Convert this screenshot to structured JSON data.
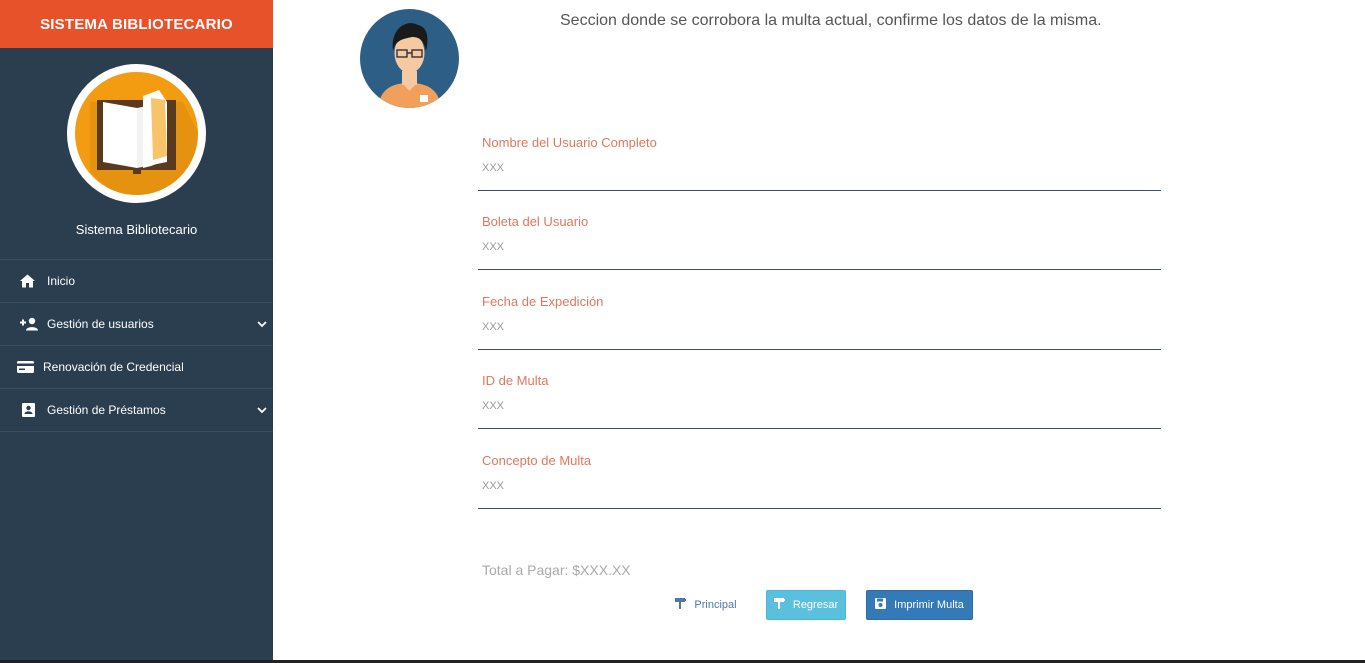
{
  "sidebar": {
    "title": "SISTEMA BIBLIOTECARIO",
    "name": "Sistema Bibliotecario",
    "items": [
      {
        "label": "Inicio",
        "icon": "home-icon"
      },
      {
        "label": "Gestión de usuarios",
        "icon": "add-user-icon"
      },
      {
        "label": "Renovación de Credencial",
        "icon": "credit-card-icon"
      },
      {
        "label": "Gestión de Préstamos",
        "icon": "contact-card-icon"
      }
    ]
  },
  "main": {
    "intro": "Seccion donde se corrobora la multa actual, confirme los datos de la misma.",
    "fields": [
      {
        "label": "Nombre del Usuario Completo",
        "value": "XXX"
      },
      {
        "label": "Boleta del Usuario",
        "value": "XXX"
      },
      {
        "label": "Fecha de Expedición",
        "value": "XXX"
      },
      {
        "label": "ID de Multa",
        "value": "XXX"
      },
      {
        "label": "Concepto de Multa",
        "value": "XXX"
      }
    ],
    "total": "Total a Pagar: $XXX.XX",
    "buttons": {
      "principal": "Principal",
      "regresar": "Regresar",
      "imprimir": "Imprimir Multa"
    }
  },
  "colors": {
    "sidebar_bg": "#2b3e50",
    "header_accent": "#e8522a",
    "label_color": "#e0785a",
    "button_info": "#5bc0de",
    "button_primary": "#337ab7"
  }
}
